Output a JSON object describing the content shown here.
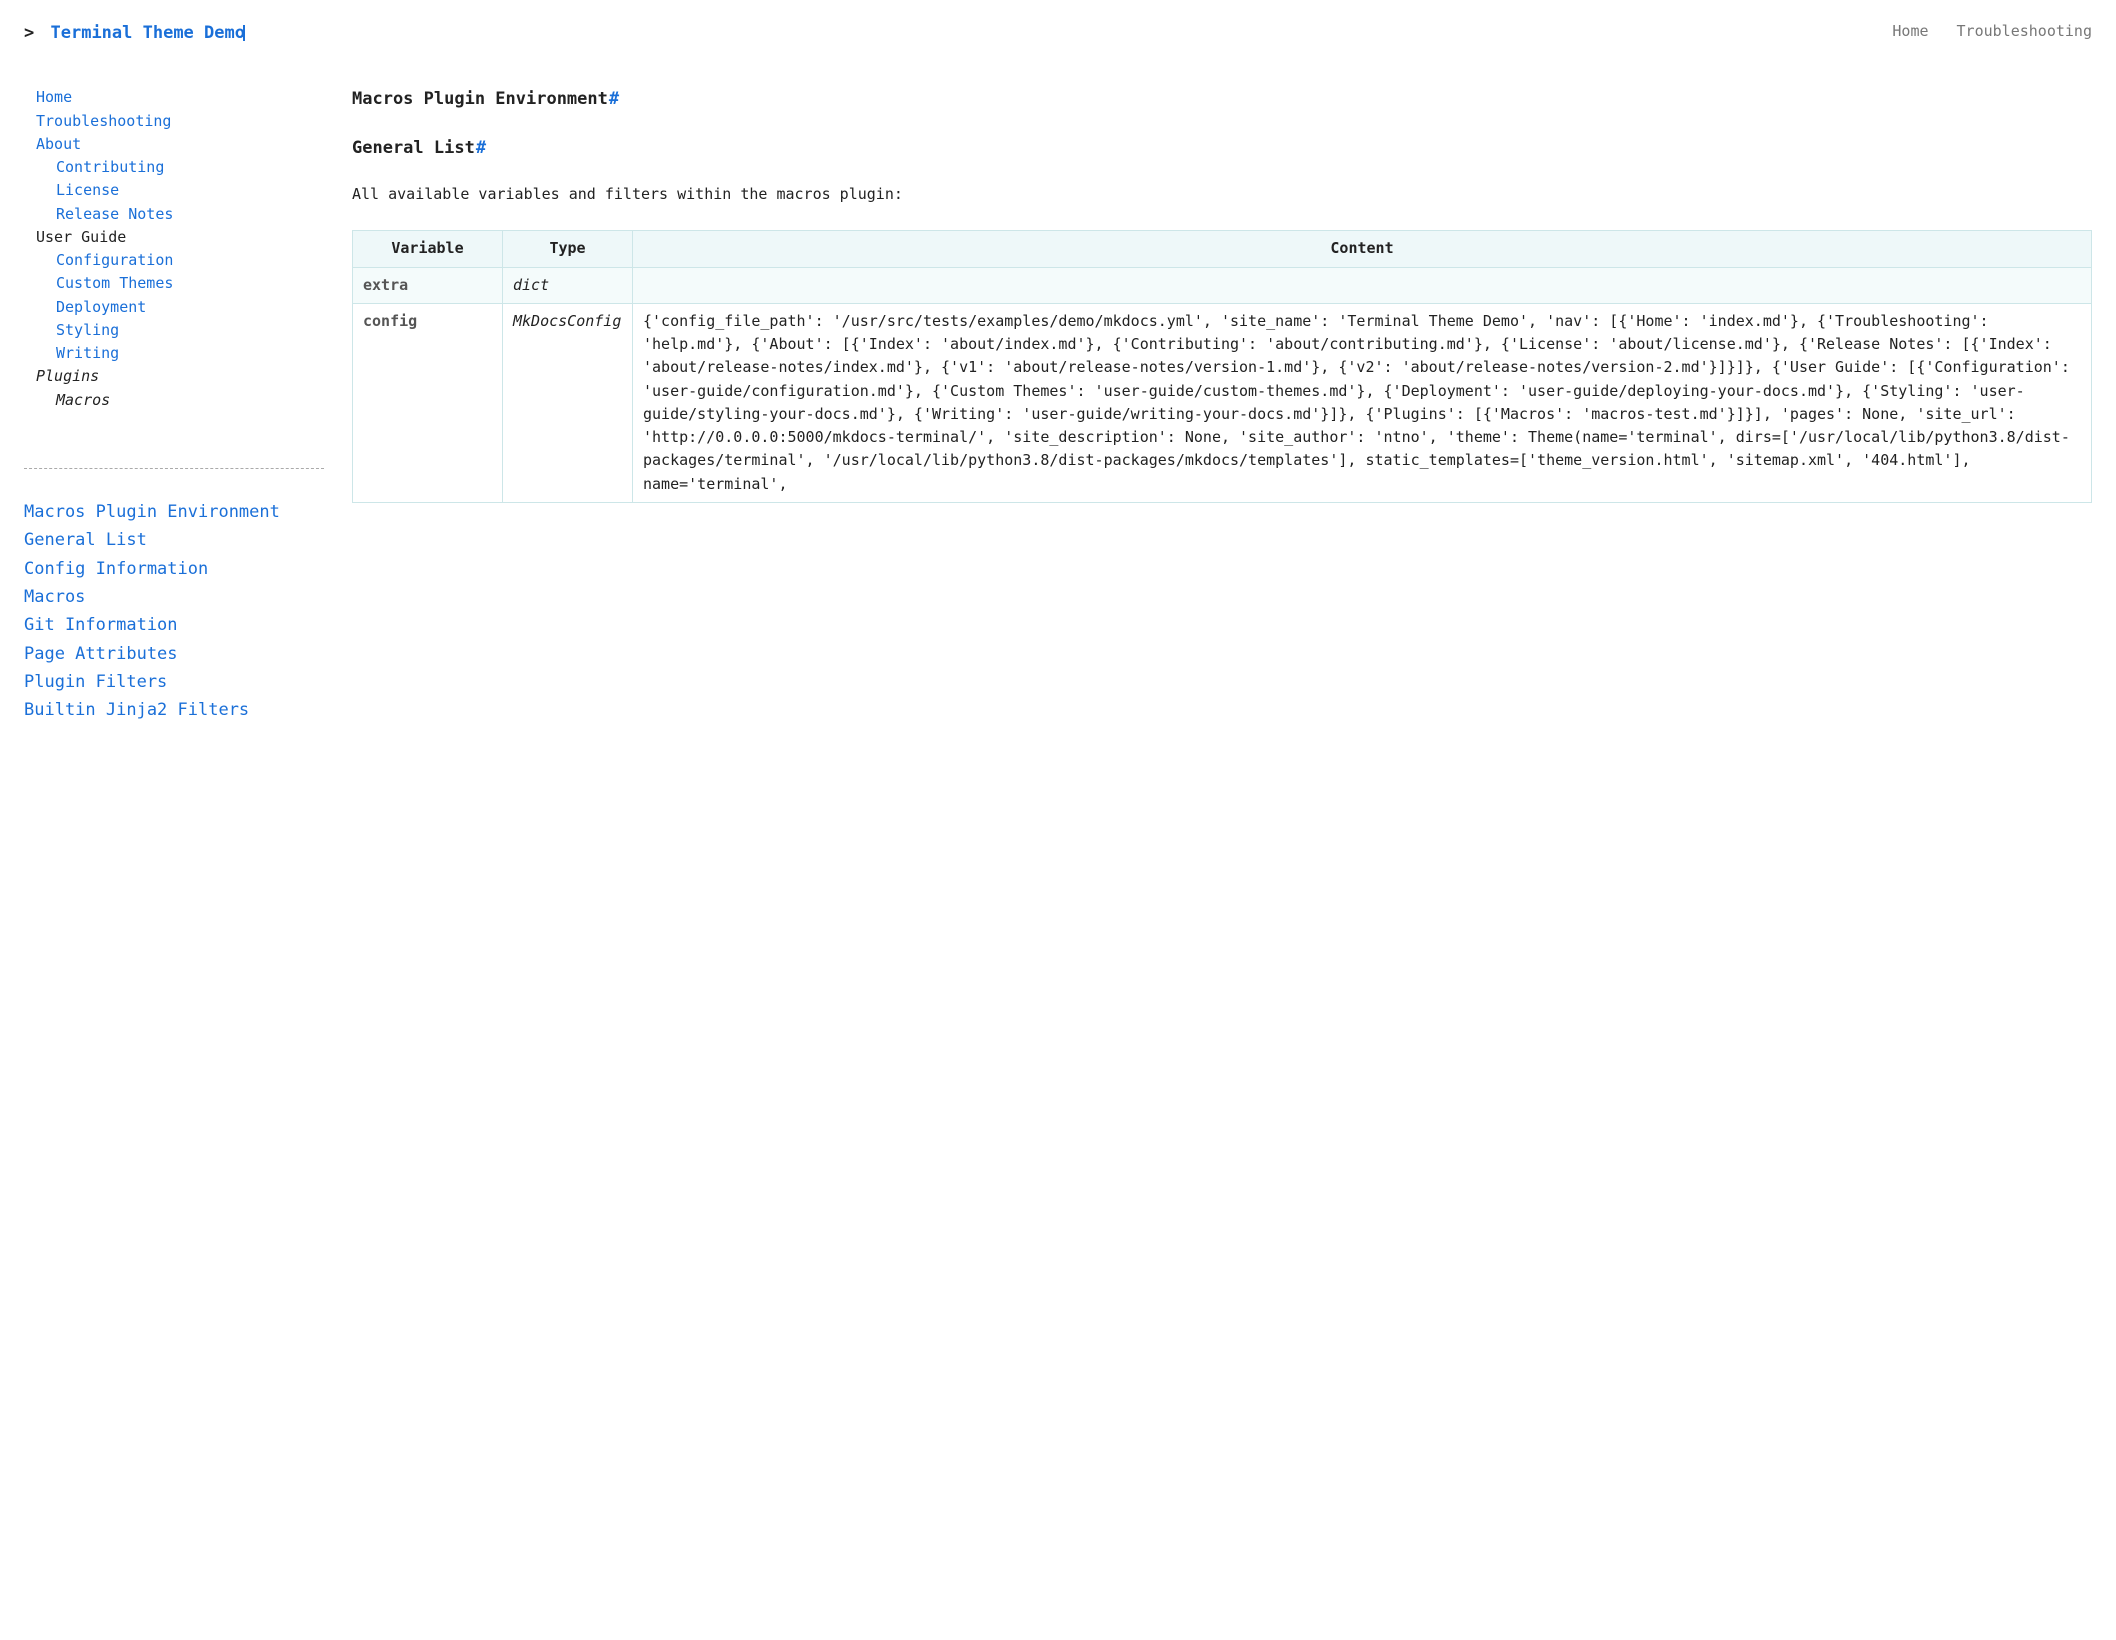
{
  "header": {
    "prompt": ">",
    "site_title": "Terminal Theme Demo",
    "topnav": [
      {
        "label": "Home"
      },
      {
        "label": "Troubleshooting"
      }
    ]
  },
  "sidenav": [
    {
      "label": "Home",
      "type": "link",
      "indent": 0
    },
    {
      "label": "Troubleshooting",
      "type": "link",
      "indent": 0
    },
    {
      "label": "About",
      "type": "link",
      "indent": 0
    },
    {
      "label": "Contributing",
      "type": "link",
      "indent": 1
    },
    {
      "label": "License",
      "type": "link",
      "indent": 1
    },
    {
      "label": "Release Notes",
      "type": "link",
      "indent": 1
    },
    {
      "label": "User Guide",
      "type": "label",
      "indent": 0
    },
    {
      "label": "Configuration",
      "type": "link",
      "indent": 1
    },
    {
      "label": "Custom Themes",
      "type": "link",
      "indent": 1
    },
    {
      "label": "Deployment",
      "type": "link",
      "indent": 1
    },
    {
      "label": "Styling",
      "type": "link",
      "indent": 1
    },
    {
      "label": "Writing",
      "type": "link",
      "indent": 1
    },
    {
      "label": "Plugins",
      "type": "italic",
      "indent": 0
    },
    {
      "label": "Macros",
      "type": "current",
      "indent": 1
    }
  ],
  "toc": [
    {
      "label": "Macros Plugin Environment"
    },
    {
      "label": "General List"
    },
    {
      "label": "Config Information"
    },
    {
      "label": "Macros"
    },
    {
      "label": "Git Information"
    },
    {
      "label": "Page Attributes"
    },
    {
      "label": "Plugin Filters"
    },
    {
      "label": "Builtin Jinja2 Filters"
    }
  ],
  "main": {
    "h1": "Macros Plugin Environment",
    "h2": "General List",
    "anchor": "#",
    "intro": "All available variables and filters within the macros plugin:",
    "table": {
      "headers": [
        "Variable",
        "Type",
        "Content"
      ],
      "rows": [
        {
          "variable": "extra",
          "type": "dict",
          "content": "",
          "hl": true
        },
        {
          "variable": "config",
          "type": "MkDocsConfig",
          "content": "{'config_file_path': '/usr/src/tests/examples/demo/mkdocs.yml', 'site_name': 'Terminal Theme Demo', 'nav': [{'Home': 'index.md'}, {'Troubleshooting': 'help.md'}, {'About': [{'Index': 'about/index.md'}, {'Contributing': 'about/contributing.md'}, {'License': 'about/license.md'}, {'Release Notes': [{'Index': 'about/release-notes/index.md'}, {'v1': 'about/release-notes/version-1.md'}, {'v2': 'about/release-notes/version-2.md'}]}]}, {'User Guide': [{'Configuration': 'user-guide/configuration.md'}, {'Custom Themes': 'user-guide/custom-themes.md'}, {'Deployment': 'user-guide/deploying-your-docs.md'}, {'Styling': 'user-guide/styling-your-docs.md'}, {'Writing': 'user-guide/writing-your-docs.md'}]}, {'Plugins': [{'Macros': 'macros-test.md'}]}], 'pages': None, 'site_url': 'http://0.0.0.0:5000/mkdocs-terminal/', 'site_description': None, 'site_author': 'ntno', 'theme': Theme(name='terminal', dirs=['/usr/local/lib/python3.8/dist-packages/terminal', '/usr/local/lib/python3.8/dist-packages/mkdocs/templates'], static_templates=['theme_version.html', 'sitemap.xml', '404.html'], name='terminal',"
        }
      ]
    }
  }
}
